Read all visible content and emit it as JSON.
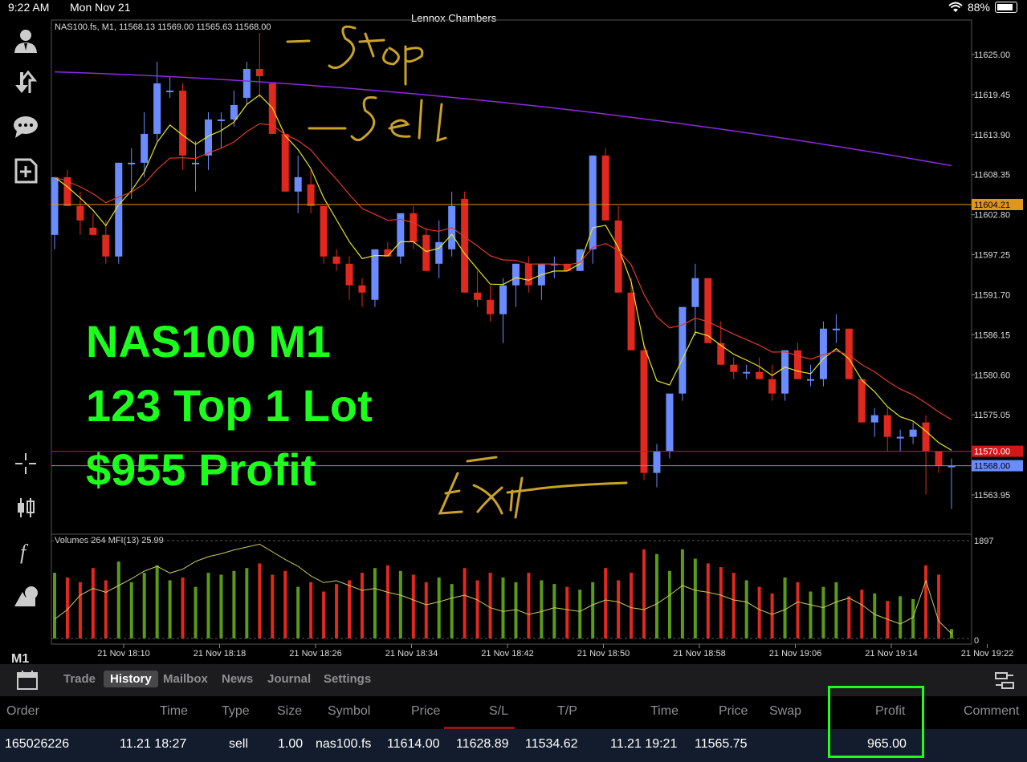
{
  "status_bar": {
    "time": "9:22 AM",
    "date": "Mon Nov 21",
    "title": "Lennox Chambers",
    "battery": "88%"
  },
  "sidebar": {
    "items": [
      "account-icon",
      "trade-arrows-icon",
      "chat-icon",
      "add-document-icon",
      "crosshair-icon",
      "candlestick-icon",
      "function-icon",
      "objects-icon"
    ],
    "timeframe": "M1"
  },
  "chart": {
    "header": "NAS100.fs, M1, 11568.13 11569.00 11565.63 11568.00",
    "price_labels": [
      "11625.00",
      "11619.45",
      "11613.90",
      "11608.35",
      "11602.80",
      "11597.25",
      "11591.70",
      "11586.15",
      "11580.60",
      "11575.05",
      "11563.95"
    ],
    "marker_labels": {
      "orange": "11604.21",
      "red": "11570.00",
      "blue": "11568.00"
    },
    "volume_header": "Volumes 264 MFI(13) 25.99",
    "volume_max": "1897",
    "volume_min": "0",
    "time_labels": [
      "21 Nov 18:10",
      "21 Nov 18:18",
      "21 Nov 18:26",
      "21 Nov 18:34",
      "21 Nov 18:42",
      "21 Nov 18:50",
      "21 Nov 18:58",
      "21 Nov 19:06",
      "21 Nov 19:14",
      "21 Nov 19:22"
    ],
    "colors": {
      "bull": "#6b8cff",
      "bear": "#e0281e",
      "vol_up": "#5a9a1a",
      "vol_down": "#e0281e",
      "ma_long": "#8a2be2",
      "ma_fast": "#e6e61e",
      "ma_slow": "#e03a2a"
    },
    "annotations": [
      "Stop",
      "Sell",
      "Exit"
    ]
  },
  "overlay": {
    "line1": "NAS100 M1",
    "line2": "123 Top 1 Lot",
    "line3": "$955 Profit",
    "color": "#1cff1c"
  },
  "tabs": {
    "items": [
      "Trade",
      "History",
      "Mailbox",
      "News",
      "Journal",
      "Settings"
    ],
    "active": "History"
  },
  "table": {
    "headers": [
      "Order",
      "Time",
      "Type",
      "Size",
      "Symbol",
      "Price",
      "S/L",
      "T/P",
      "Time",
      "Price",
      "Swap",
      "Profit",
      "Comment"
    ],
    "row": {
      "order": "165026226",
      "open_time": "11.21 18:27",
      "type": "sell",
      "size": "1.00",
      "symbol": "nas100.fs",
      "open_price": "11614.00",
      "sl": "11628.89",
      "tp": "11534.62",
      "close_time": "11.21 19:21",
      "close_price": "11565.75",
      "swap": "",
      "profit": "965.00",
      "comment": ""
    }
  }
}
